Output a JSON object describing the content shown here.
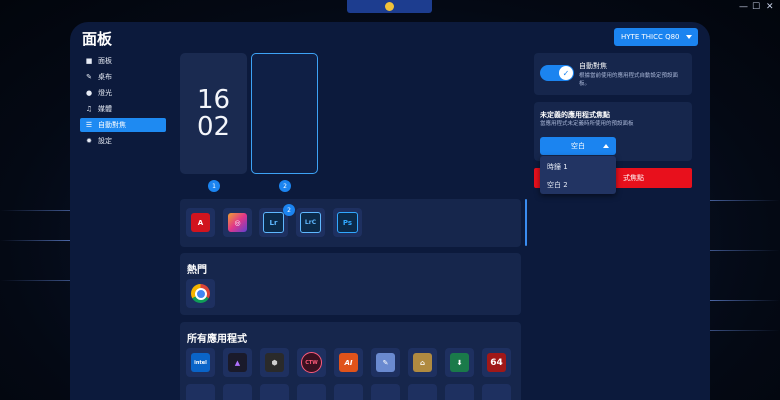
{
  "window": {
    "controls": [
      "—",
      "☐",
      "✕"
    ]
  },
  "header": {
    "title": "面板",
    "device_select": "HYTE THICC Q80"
  },
  "sidebar": {
    "items": [
      {
        "label": "面板",
        "icon": "square-icon",
        "glyph": "■"
      },
      {
        "label": "桌布",
        "icon": "brush-icon",
        "glyph": "✎"
      },
      {
        "label": "燈光",
        "icon": "bulb-icon",
        "glyph": "●"
      },
      {
        "label": "媒體",
        "icon": "music-icon",
        "glyph": "♫"
      },
      {
        "label": "自動對焦",
        "icon": "sliders-icon",
        "glyph": "☰",
        "active": true
      },
      {
        "label": "設定",
        "icon": "gear-icon",
        "glyph": "✹"
      }
    ]
  },
  "screens": {
    "clock_hour": "16",
    "clock_minute": "02",
    "badge1": "1",
    "badge2": "2"
  },
  "apps": {
    "pinned_badge": "2",
    "pinned": [
      {
        "name": "Acrobat",
        "text": "A",
        "color": "#d1141e"
      },
      {
        "name": "Creative Cloud",
        "text": "◎",
        "color": "#e0368a"
      },
      {
        "name": "Lightroom",
        "text": "Lr",
        "color": "#0b2a4a"
      },
      {
        "name": "Lightroom Classic",
        "text": "LrC",
        "color": "#0b2a4a"
      },
      {
        "name": "Photoshop",
        "text": "Ps",
        "color": "#0b2a4a"
      }
    ],
    "popular_title": "熱門",
    "popular": [
      {
        "name": "Chrome",
        "text": "",
        "color": "#ffffff"
      }
    ],
    "all_title": "所有應用程式",
    "all": [
      {
        "name": "Intel",
        "text": "intel",
        "color": "#0a64c8"
      },
      {
        "name": "App2",
        "text": "▲",
        "color": "#1a1a2a"
      },
      {
        "name": "App3",
        "text": "⬢",
        "color": "#2a2a2a"
      },
      {
        "name": "CTW",
        "text": "CTW",
        "color": "#3a1020"
      },
      {
        "name": "App5",
        "text": "AI",
        "color": "#e0531a"
      },
      {
        "name": "App6",
        "text": "✎",
        "color": "#6a8ad0"
      },
      {
        "name": "App7",
        "text": "⌂",
        "color": "#b08a40"
      },
      {
        "name": "App8",
        "text": "⬇",
        "color": "#1a7a4a"
      },
      {
        "name": "App9",
        "text": "64",
        "color": "#a01818"
      }
    ]
  },
  "autofocus": {
    "title": "自動對焦",
    "desc": "根據當前使用的應用程式自動設定預設面板。"
  },
  "undefined_focus": {
    "title": "未定義的應用程式焦點",
    "desc": "當應用程式未定義時所使用的預設面板",
    "selected": "空白",
    "options": [
      "時鐘 1",
      "空白 2"
    ],
    "red_button": "式焦點"
  },
  "colors": {
    "accent": "#1b84f0",
    "window_bg": "#0c1a3c",
    "panel_bg": "#16264c",
    "danger": "#e8101c"
  }
}
